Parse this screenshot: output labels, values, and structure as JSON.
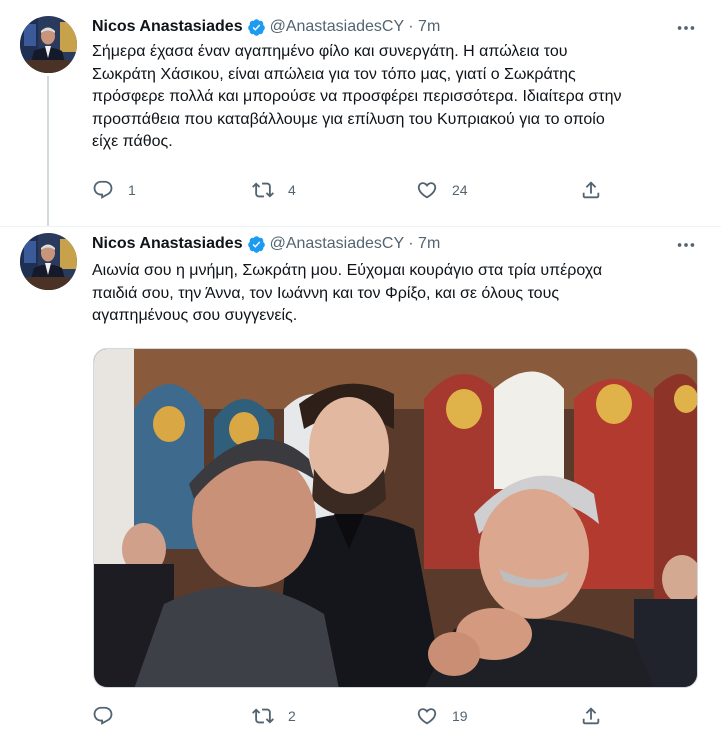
{
  "tweets": [
    {
      "author_name": "Nicos Anastasiades",
      "handle_time": "@AnastasiadesCY · 7m",
      "text": "Σήμερα έχασα έναν αγαπημένο φίλο και συνεργάτη. Η απώλεια του\nΣωκράτη Χάσικου, είναι απώλεια για τον τόπο μας, γιατί ο Σωκράτης\nπρόσφερε πολλά και μπορούσε να προσφέρει περισσότερα. Ιδιαίτερα στην\nπροσπάθεια που καταβάλλουμε για  επίλυση του Κυπριακού για το οποίο\nείχε πάθος.",
      "reply_count": "1",
      "retweet_count": "4",
      "like_count": "24"
    },
    {
      "author_name": "Nicos Anastasiades",
      "handle_time": "@AnastasiadesCY · 7m",
      "text": "Αιωνία σου η μνήμη, Σωκράτη μου. Εύχομαι κουράγιο στα τρία υπέροχα\nπαιδιά σου, την Άννα, τον Ιωάννη και τον Φρίξο, και σε όλους τους\nαγαπημένους σου συγγενείς.",
      "reply_count": "",
      "retweet_count": "2",
      "like_count": "19"
    }
  ],
  "colors": {
    "verified": "#1d9bf0",
    "secondary_text": "#536471",
    "thread_line": "#cfd9de"
  },
  "icons": [
    "avatar",
    "verified-badge-icon",
    "more-icon",
    "reply-icon",
    "retweet-icon",
    "like-icon",
    "share-icon"
  ]
}
